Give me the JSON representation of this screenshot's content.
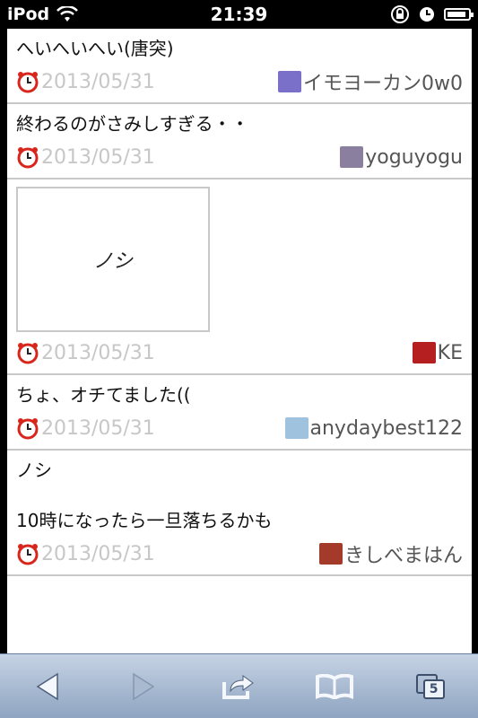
{
  "statusbar": {
    "carrier": "iPod",
    "time": "21:39"
  },
  "posts": [
    {
      "text": "へいへいへい(唐突)",
      "date": "2013/05/31",
      "user": "イモヨーカン0w0",
      "avatar_color": "#7a6fc9"
    },
    {
      "text": "終わるのがさみしすぎる・・",
      "date": "2013/05/31",
      "user": "yoguyogu",
      "avatar_color": "#8b7fa0"
    },
    {
      "image_text": "ノシ",
      "date": "2013/05/31",
      "user": "KE",
      "avatar_color": "#b51f1f"
    },
    {
      "text": "ちょ、オチてました((",
      "date": "2013/05/31",
      "user": "anydaybest122",
      "avatar_color": "#9fc3df"
    },
    {
      "text": "ノシ\n\n10時になったら一旦落ちるかも",
      "date": "2013/05/31",
      "user": "きしべまはん",
      "avatar_color": "#a33a2a"
    }
  ],
  "toolbar": {
    "tabs_count": "5",
    "icons": [
      "back-icon",
      "forward-icon",
      "share-icon",
      "bookmarks-icon",
      "tabs-icon"
    ]
  },
  "colors": {
    "date_gray": "#c7c7c7",
    "toolbar_top": "#c6d3e4",
    "toolbar_bottom": "#8ea4c1",
    "clock_red": "#d9261c"
  }
}
